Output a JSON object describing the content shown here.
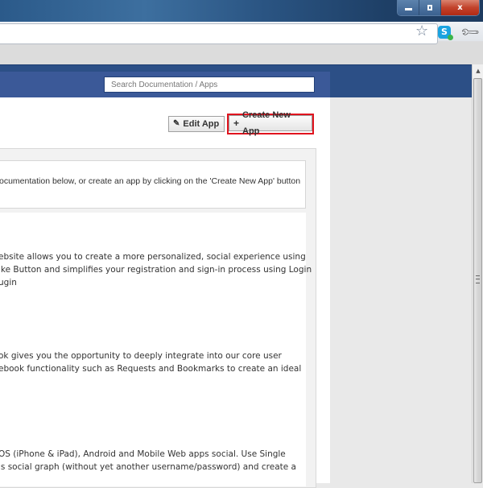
{
  "window": {
    "controls": {
      "minimize_icon": "minimize-icon",
      "restore_icon": "restore-icon",
      "close_label": "x"
    }
  },
  "toolbar": {
    "address_value": "",
    "bookmark_icon": "star-icon",
    "extension_icon": "skype-icon",
    "extension_label": "S",
    "menu_icon": "wrench-icon"
  },
  "header": {
    "search_placeholder": "Search Documentation / Apps",
    "brand_color": "#3b5998"
  },
  "actions": {
    "edit_label": "Edit App",
    "create_label": "Create New App",
    "highlight_color": "#e0141e"
  },
  "intro": {
    "text": "ocumentation below, or create an app by clicking on the 'Create New App' button"
  },
  "sections": [
    {
      "lines": [
        "ebsite allows you to create a more personalized, social experience using",
        "ike Button and simplifies your registration and sign-in process using Login",
        "ugin"
      ]
    },
    {
      "lines": [
        "ok gives you the opportunity to deeply integrate into our core user",
        "ebook functionality such as Requests and Bookmarks to create an ideal"
      ]
    },
    {
      "lines": [
        "OS (iPhone & iPad), Android and Mobile Web apps social. Use Single",
        "'s social graph (without yet another username/password) and create a"
      ]
    }
  ]
}
